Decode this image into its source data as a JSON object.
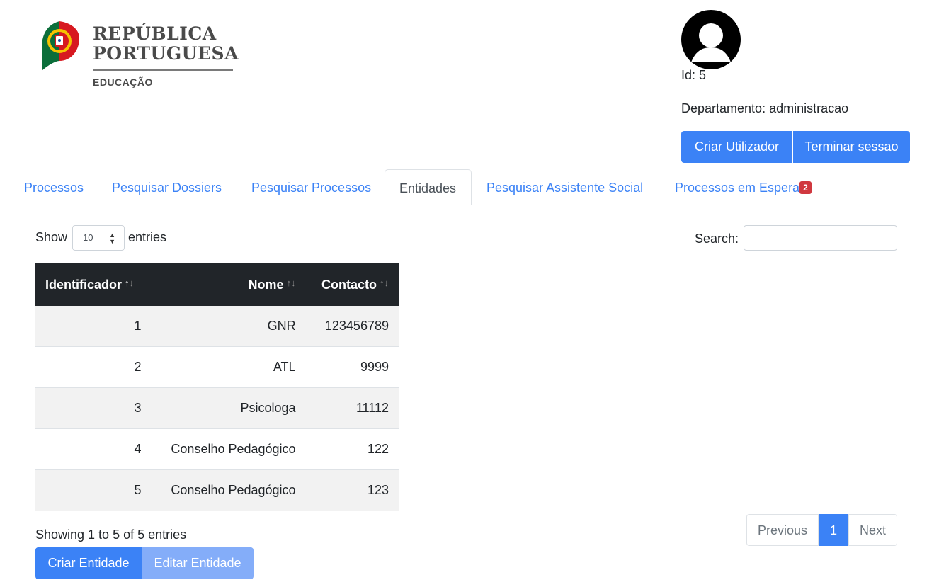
{
  "branding": {
    "line1": "REPÚBLICA",
    "line2": "PORTUGUESA",
    "line3": "EDUCAÇÃO",
    "colors": {
      "green": "#0b6e3a",
      "red": "#d71920",
      "yellow": "#f6c400"
    }
  },
  "user": {
    "avatar_icon": "user-avatar-icon",
    "id_text": "Id: 5",
    "department_text": "Departamento: administracao",
    "create_user_label": "Criar Utilizador",
    "logout_label": "Terminar sessao"
  },
  "tabs": [
    {
      "label": "Processos",
      "active": false
    },
    {
      "label": "Pesquisar Dossiers",
      "active": false
    },
    {
      "label": "Pesquisar Processos",
      "active": false
    },
    {
      "label": "Entidades",
      "active": true
    },
    {
      "label": "Pesquisar Assistente Social",
      "active": false
    },
    {
      "label": "Processos em Espera",
      "active": false,
      "badge": "2"
    }
  ],
  "length_control": {
    "prefix": "Show",
    "value": "10",
    "suffix": "entries"
  },
  "search": {
    "label": "Search:",
    "value": ""
  },
  "table": {
    "columns": [
      "Identificador",
      "Nome",
      "Contacto"
    ],
    "rows": [
      [
        "1",
        "GNR",
        "123456789"
      ],
      [
        "2",
        "ATL",
        "9999"
      ],
      [
        "3",
        "Psicologa",
        "11112"
      ],
      [
        "4",
        "Conselho Pedagógico",
        "122"
      ],
      [
        "5",
        "Conselho Pedagógico",
        "123"
      ]
    ]
  },
  "info_text": "Showing 1 to 5 of 5 entries",
  "pagination": {
    "previous": "Previous",
    "current": "1",
    "next": "Next"
  },
  "actions": {
    "create_entity": "Criar Entidade",
    "edit_entity": "Editar Entidade"
  },
  "colors": {
    "primary": "#3b82f6",
    "primary_disabled": "#84adf9",
    "table_header": "#212529",
    "badge": "#d0383f"
  }
}
